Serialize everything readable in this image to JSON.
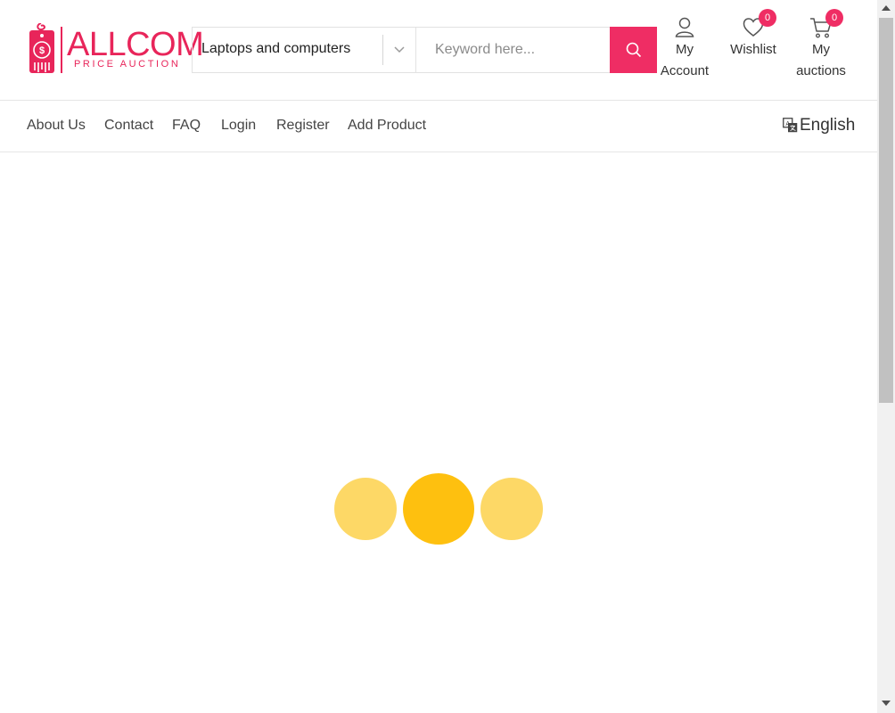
{
  "logo": {
    "title": "ALLCOM",
    "subtitle": "PRICE AUCTION",
    "tag_symbol": "$"
  },
  "search": {
    "category_value": "Laptops and computers",
    "placeholder": "Keyword here...",
    "button_icon": "search-icon"
  },
  "header_actions": {
    "account": {
      "line1": "My",
      "line2": "Account",
      "icon": "user-icon"
    },
    "wishlist": {
      "label": "Wishlist",
      "count": "0",
      "icon": "heart-icon"
    },
    "auctions": {
      "line1": "My",
      "line2": "auctions",
      "count": "0",
      "icon": "cart-icon"
    }
  },
  "nav": {
    "links": [
      "About Us",
      "Contact",
      "FAQ",
      "Login",
      "Register",
      "Add Product"
    ],
    "language": "English",
    "language_icon": "translate-icon"
  },
  "colors": {
    "brand": "#ef2d64",
    "loader_light": "#fdd866",
    "loader_dark": "#fec00f"
  }
}
